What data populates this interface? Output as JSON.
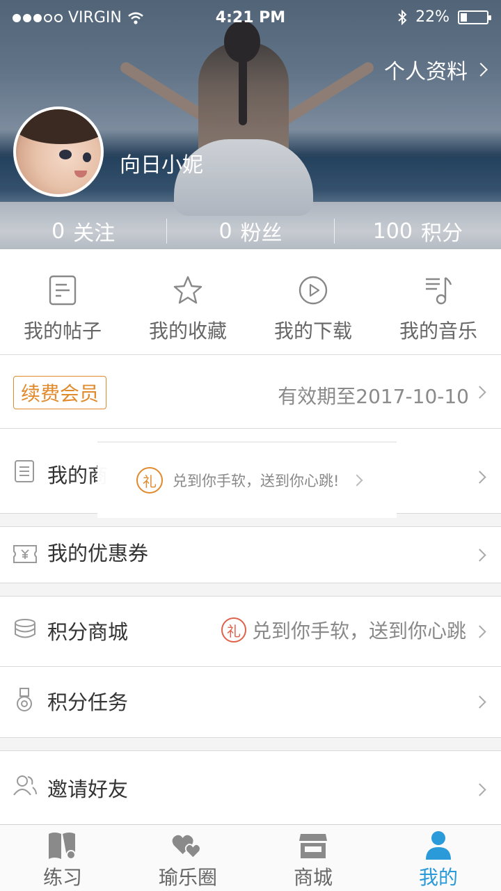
{
  "status_bar": {
    "carrier": "VIRGIN",
    "time": "4:21 PM",
    "battery": "22%",
    "battery_level": 0.22
  },
  "header": {
    "profile_link": "个人资料",
    "username": "向日小妮",
    "stats": [
      {
        "value": "0",
        "label": "关注"
      },
      {
        "value": "0",
        "label": "粉丝"
      },
      {
        "value": "100",
        "label": "积分"
      }
    ]
  },
  "quick_links": [
    {
      "label": "我的帖子",
      "icon": "post-icon"
    },
    {
      "label": "我的收藏",
      "icon": "star-icon"
    },
    {
      "label": "我的下载",
      "icon": "play-icon"
    },
    {
      "label": "我的音乐",
      "icon": "music-icon"
    }
  ],
  "member": {
    "tag": "续费会员",
    "expiry": "有效期至2017-10-10"
  },
  "list": {
    "orders": {
      "label": "我的商"
    },
    "coupons": {
      "label": "我的优惠券"
    },
    "points_mall": {
      "label": "积分商城",
      "promo": "兑到你手软，送到你心跳",
      "badge": "礼"
    },
    "points_tasks": {
      "label": "积分任务"
    },
    "invite": {
      "label": "邀请好友"
    }
  },
  "toast": {
    "badge": "礼",
    "text": "兑到你手软，送到你心跳!"
  },
  "tabbar": [
    {
      "label": "练习",
      "active": false
    },
    {
      "label": "瑜乐圈",
      "active": false
    },
    {
      "label": "商城",
      "active": false
    },
    {
      "label": "我的",
      "active": true
    }
  ],
  "colors": {
    "accent": "#2a9ad8",
    "member": "#e08a2c",
    "gift": "#e0604a"
  }
}
